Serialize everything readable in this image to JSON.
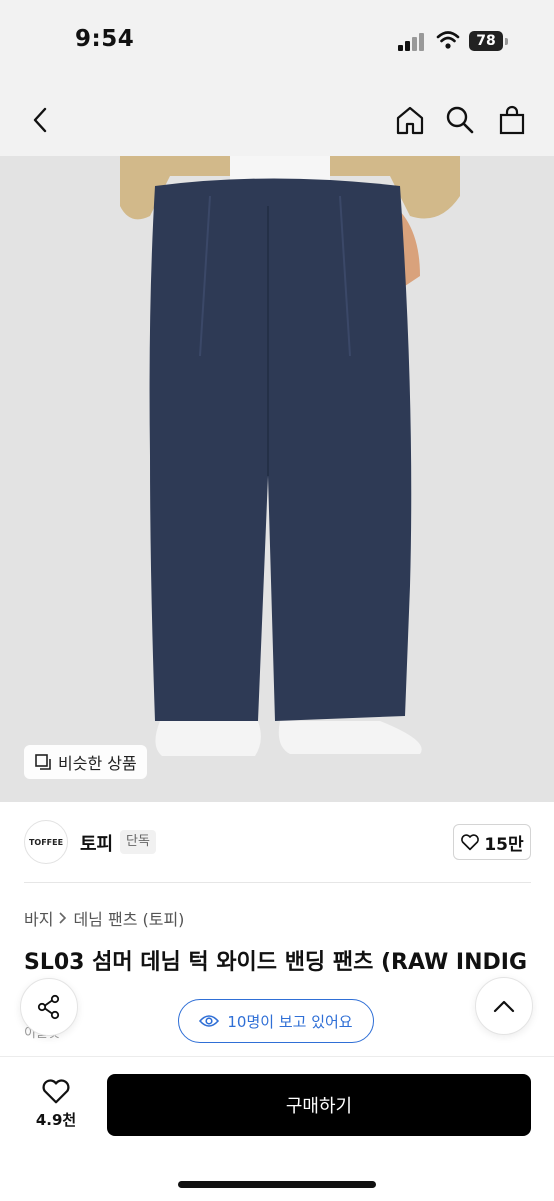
{
  "status": {
    "time": "9:54",
    "battery": "78"
  },
  "nav": {
    "back_icon": "chevron-left-icon",
    "home_icon": "home-icon",
    "search_icon": "search-icon",
    "cart_icon": "shopping-bag-icon"
  },
  "hero": {
    "similar_label": "비슷한 상품"
  },
  "brand": {
    "logo_text": "TOFFEE",
    "name": "토피",
    "tag": "단독",
    "like_count": "15만"
  },
  "breadcrumb": {
    "category": "바지",
    "sub": "데님 팬츠 (토피)"
  },
  "product": {
    "title": "SL03 섬머 데님 턱 와이드 밴딩 팬츠 (RAW INDIG",
    "sub_text": "이들컷"
  },
  "floating": {
    "viewers": "10명이 보고 있어요"
  },
  "bottom": {
    "wish_count": "4.9천",
    "buy_label": "구매하기"
  },
  "colors": {
    "accent": "#2f6fd6",
    "buy_button": "#000000"
  }
}
